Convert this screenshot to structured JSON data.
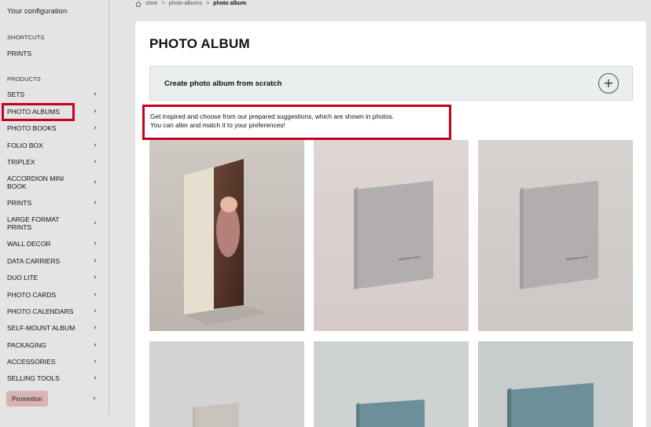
{
  "sidebar": {
    "config_label": "Your configuration",
    "shortcuts_heading": "SHORTCUTS",
    "shortcut_prints": "PRINTS",
    "products_heading": "PRODUCTS",
    "items": [
      {
        "label": "SETS"
      },
      {
        "label": "PHOTO ALBUMS"
      },
      {
        "label": "PHOTO BOOKS"
      },
      {
        "label": "FOLIO BOX"
      },
      {
        "label": "TRIPLEX"
      },
      {
        "label": "ACCORDION MINI BOOK"
      },
      {
        "label": "PRINTS"
      },
      {
        "label": "LARGE FORMAT PRINTS"
      },
      {
        "label": "WALL DECOR"
      },
      {
        "label": "DATA CARRIERS"
      },
      {
        "label": "DUO LITE"
      },
      {
        "label": "PHOTO CARDS"
      },
      {
        "label": "PHOTO CALENDARS"
      },
      {
        "label": "SELF-MOUNT ALBUM"
      },
      {
        "label": "PACKAGING"
      },
      {
        "label": "ACCESSORIES"
      },
      {
        "label": "SELLING TOOLS"
      }
    ],
    "promotion_label": "Promotion",
    "chevron": "›"
  },
  "breadcrumb": {
    "home": "store",
    "sep": ">",
    "level1": "photo-albums",
    "current": "photo album"
  },
  "main": {
    "title": "PHOTO ALBUM",
    "create_label": "Create photo album from scratch",
    "plus": "+",
    "inspire_line1": "Get inspired and choose from our prepared suggestions, which are shown in photos.",
    "inspire_line2": "You can alter and match it to your preferences!",
    "album_brand_text": "WEDDING PRINT"
  },
  "colors": {
    "highlight": "#c8001e",
    "promo_bg": "#d8b3b3",
    "linen_grey": "#b2aeb0",
    "linen_blue": "#6d8f99"
  },
  "icons": {
    "home": "home-icon",
    "plus": "plus-icon",
    "chevron": "chevron-right-icon"
  }
}
